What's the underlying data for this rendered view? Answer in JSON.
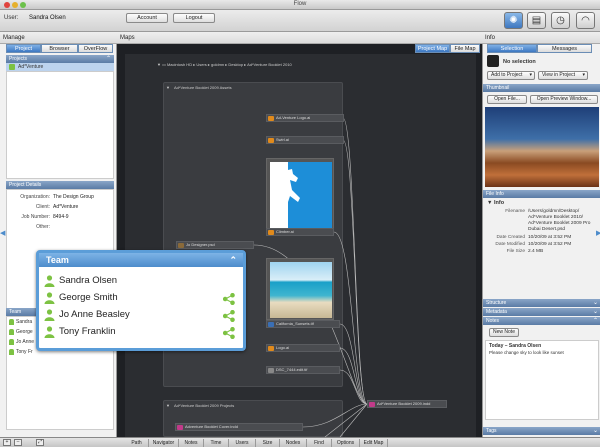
{
  "window": {
    "title": "Flow"
  },
  "topbar": {
    "user_label": "User:",
    "user_name": "Sandra Olsen",
    "account_btn": "Account",
    "logout_btn": "Logout"
  },
  "columns": {
    "manage": "Manage",
    "maps": "Maps",
    "info": "Info"
  },
  "left": {
    "tabs": [
      "Project",
      "Browser",
      "OverFlow"
    ],
    "projects_header": "Projects",
    "project_item": "Ad*Venture",
    "details_header": "Project Details",
    "details": [
      {
        "k": "Organization:",
        "v": "The Design Group"
      },
      {
        "k": "Client:",
        "v": "Ad*Venture"
      },
      {
        "k": "Job Number:",
        "v": "8494-9"
      },
      {
        "k": "Other:",
        "v": ""
      }
    ],
    "team_header": "Team",
    "team_small": [
      "Sandra",
      "George",
      "Jo Anne",
      "Tony Fr"
    ]
  },
  "maps": {
    "tabs": [
      "Project Map",
      "File Map"
    ],
    "breadcrumb": [
      "Macintosh HD",
      "Users",
      "goldmn",
      "Desktop",
      "Ad*Venture Booklet 2010"
    ],
    "group1": "Ad*Venture Booklet 2009 Assets",
    "group2": "Ad*Venture Booklet 2009 Projects",
    "nodes": {
      "n1": "Ad-Venture Logo.ai",
      "n2": "Swirl.ai",
      "n3": "Climber.ai",
      "n4": "Jo Designer.psd",
      "n5": "California_Sunsets.tif",
      "n6": "Logo.ai",
      "n7": "DSC_7444.edit.tif",
      "n8": "Ad*Venture Booklet 2009.indd",
      "n9": "Adventure Booklet Cover.indd"
    }
  },
  "bottom_tabs": [
    "Path",
    "Navigator",
    "Notes",
    "Time",
    "Users",
    "Size",
    "Nodes",
    "Find",
    "Options",
    "Edit Map"
  ],
  "team_popup": {
    "title": "Team",
    "members": [
      "Sandra Olsen",
      "George Smith",
      "Jo Anne Beasley",
      "Tony Franklin"
    ]
  },
  "right": {
    "tabs": [
      "Selection",
      "Messages"
    ],
    "no_selection": "No selection",
    "add_to_project": "Add to Project",
    "view_in_project": "View in Project",
    "thumbnail_header": "Thumbnail",
    "open_file": "Open File...",
    "open_preview": "Open Preview Window...",
    "fileinfo_header": "File Info",
    "info_label": "Info",
    "info": [
      {
        "k": "Filename",
        "v": "/Users/goldmn/Desktop/"
      },
      {
        "k": "",
        "v": "Ad*Venture Booklet 2010/"
      },
      {
        "k": "",
        "v": "Ad*Venture Booklet 2009 Pro"
      },
      {
        "k": "",
        "v": "Dubai Desert.psd"
      },
      {
        "k": "Date Created",
        "v": "10/20/09 at 3:52 PM"
      },
      {
        "k": "Date Modified",
        "v": "10/20/09 at 3:52 PM"
      },
      {
        "k": "File Size",
        "v": "2.4 MB"
      }
    ],
    "structure_header": "Structure",
    "metadata_header": "Metadata",
    "notes_header": "Notes",
    "new_note": "New Note",
    "note_title": "Today – Sandra Olsen",
    "note_text": "Please change sky to look like sunset",
    "tags_header": "Tags"
  },
  "colors": {
    "accent": "#4d8ccb",
    "section": "#5a7ba5",
    "canvas": "#2b2d31",
    "person": "#7dc243"
  }
}
